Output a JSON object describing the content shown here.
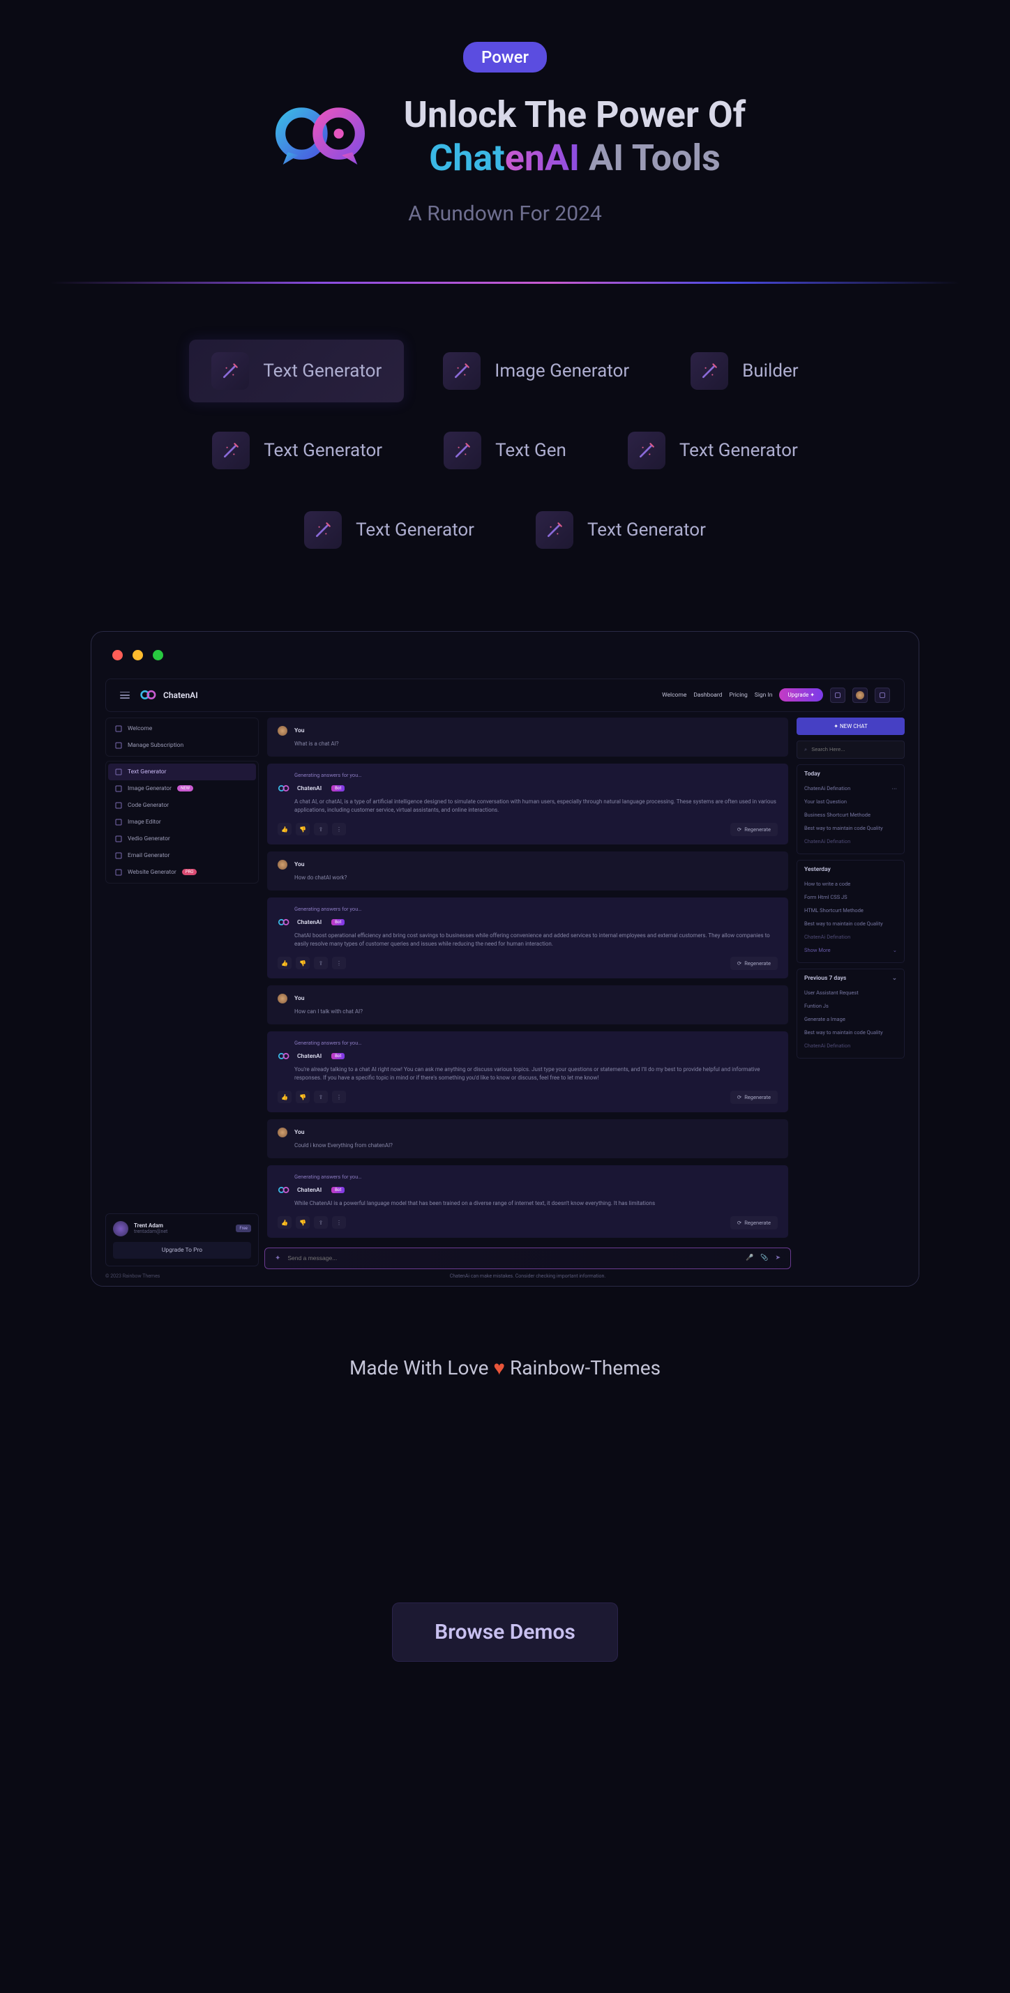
{
  "hero": {
    "badge": "Power",
    "title_pre": "Unlock The Power Of",
    "brand_a": "Chat",
    "brand_b": "enAI",
    "brand_c": " AI Tools",
    "subtitle": "A Rundown For 2024"
  },
  "categories": [
    {
      "label": "Text Generator",
      "active": true
    },
    {
      "label": "Image Generator",
      "active": false
    },
    {
      "label": "Builder",
      "active": false
    },
    {
      "label": "Text Generator",
      "active": false
    },
    {
      "label": "Text Gen",
      "active": false
    },
    {
      "label": "Text Generator",
      "active": false
    },
    {
      "label": "Text Generator",
      "active": false
    },
    {
      "label": "Text Generator",
      "active": false
    }
  ],
  "app": {
    "brand": "ChatenAI",
    "nav": [
      "Welcome",
      "Dashboard",
      "Pricing",
      "Sign In"
    ],
    "upgrade": "Upgrade ✦"
  },
  "sidebar_top": [
    {
      "icon": "home",
      "label": "Welcome"
    },
    {
      "icon": "card",
      "label": "Manage Subscription"
    }
  ],
  "sidebar_tools": [
    {
      "icon": "text",
      "label": "Text Generator",
      "active": true
    },
    {
      "icon": "image",
      "label": "Image Generator",
      "badge": "NEW",
      "badgeCls": "new"
    },
    {
      "icon": "code",
      "label": "Code Generator"
    },
    {
      "icon": "image",
      "label": "Image Editor"
    },
    {
      "icon": "video",
      "label": "Vedio Generator"
    },
    {
      "icon": "mail",
      "label": "Email Generator"
    },
    {
      "icon": "globe",
      "label": "Website Generator",
      "badge": "PRO",
      "badgeCls": "pro"
    }
  ],
  "profile": {
    "name": "Trent Adam",
    "email": "trentadam@net",
    "plan": "Free",
    "upgrade_btn": "Upgrade To Pro",
    "copyright": "© 2023 Rainbow Themes"
  },
  "chat": [
    {
      "role": "user",
      "name": "You",
      "text": "What is a chat AI?"
    },
    {
      "role": "bot",
      "name": "ChatenAI",
      "gen": "Generating answers for you…",
      "text": "A chat AI, or chatAI, is a type of artificial intelligence designed to simulate conversation with human users, especially through natural language processing. These systems are often used in various applications, including customer service, virtual assistants, and online interactions.",
      "regen": "Regenerate"
    },
    {
      "role": "user",
      "name": "You",
      "text": "How do chatAI work?"
    },
    {
      "role": "bot",
      "name": "ChatenAI",
      "gen": "Generating answers for you…",
      "text": "ChatAI boost operational efficiency and bring cost savings to businesses while offering convenience and added services to internal employees and external customers. They allow companies to easily resolve many types of customer queries and issues while reducing the need for human interaction.",
      "regen": "Regenerate"
    },
    {
      "role": "user",
      "name": "You",
      "text": "How can I talk with chat AI?"
    },
    {
      "role": "bot",
      "name": "ChatenAI",
      "gen": "Generating answers for you…",
      "text": "You're already talking to a chat AI right now! You can ask me anything or discuss various topics. Just type your questions or statements, and I'll do my best to provide helpful and informative responses. If you have a specific topic in mind or if there's something you'd like to know or discuss, feel free to let me know!",
      "regen": "Regenerate"
    },
    {
      "role": "user",
      "name": "You",
      "text": "Could i know Everything from chatenAI?"
    },
    {
      "role": "bot",
      "name": "ChatenAI",
      "gen": "Generating answers for you…",
      "text": "While ChatenAI is a powerful language model that has been trained on a diverse range of internet text, it doesn't know everything. It has limitations",
      "regen": "Regenerate"
    }
  ],
  "bot_badge": "Bot",
  "input_placeholder": "Send a message...",
  "disclaimer": "ChatenAi can make mistakes. Consider checking important information.",
  "right": {
    "newchat": "✦  NEW CHAT",
    "search": "Search Here...",
    "groups": [
      {
        "title": "Today",
        "items": [
          {
            "t": "ChatenAi Defination",
            "dots": true
          },
          {
            "t": "Your last Question"
          },
          {
            "t": "Business Shortcurt Methode"
          },
          {
            "t": "Best way to maintain code Quality"
          },
          {
            "t": "ChatenAi Defination",
            "faded": true
          }
        ]
      },
      {
        "title": "Yesterday",
        "items": [
          {
            "t": "How to write a code"
          },
          {
            "t": "Form Html CSS JS"
          },
          {
            "t": "HTML Shortcurt Methode"
          },
          {
            "t": "Best way to maintain code Quality"
          },
          {
            "t": "ChatenAi Defination",
            "faded": true
          }
        ],
        "showmore": "Show More"
      },
      {
        "title": "Previous 7 days",
        "items": [
          {
            "t": "User Assistant Request"
          },
          {
            "t": "Funtion Js"
          },
          {
            "t": "Generate a Image"
          },
          {
            "t": "Best way to maintain code Quality"
          },
          {
            "t": "ChatenAi Defination",
            "faded": true
          }
        ]
      }
    ]
  },
  "footer": {
    "made": "Made With Love",
    "themes": "Rainbow-Themes",
    "browse": "Browse Demos"
  }
}
